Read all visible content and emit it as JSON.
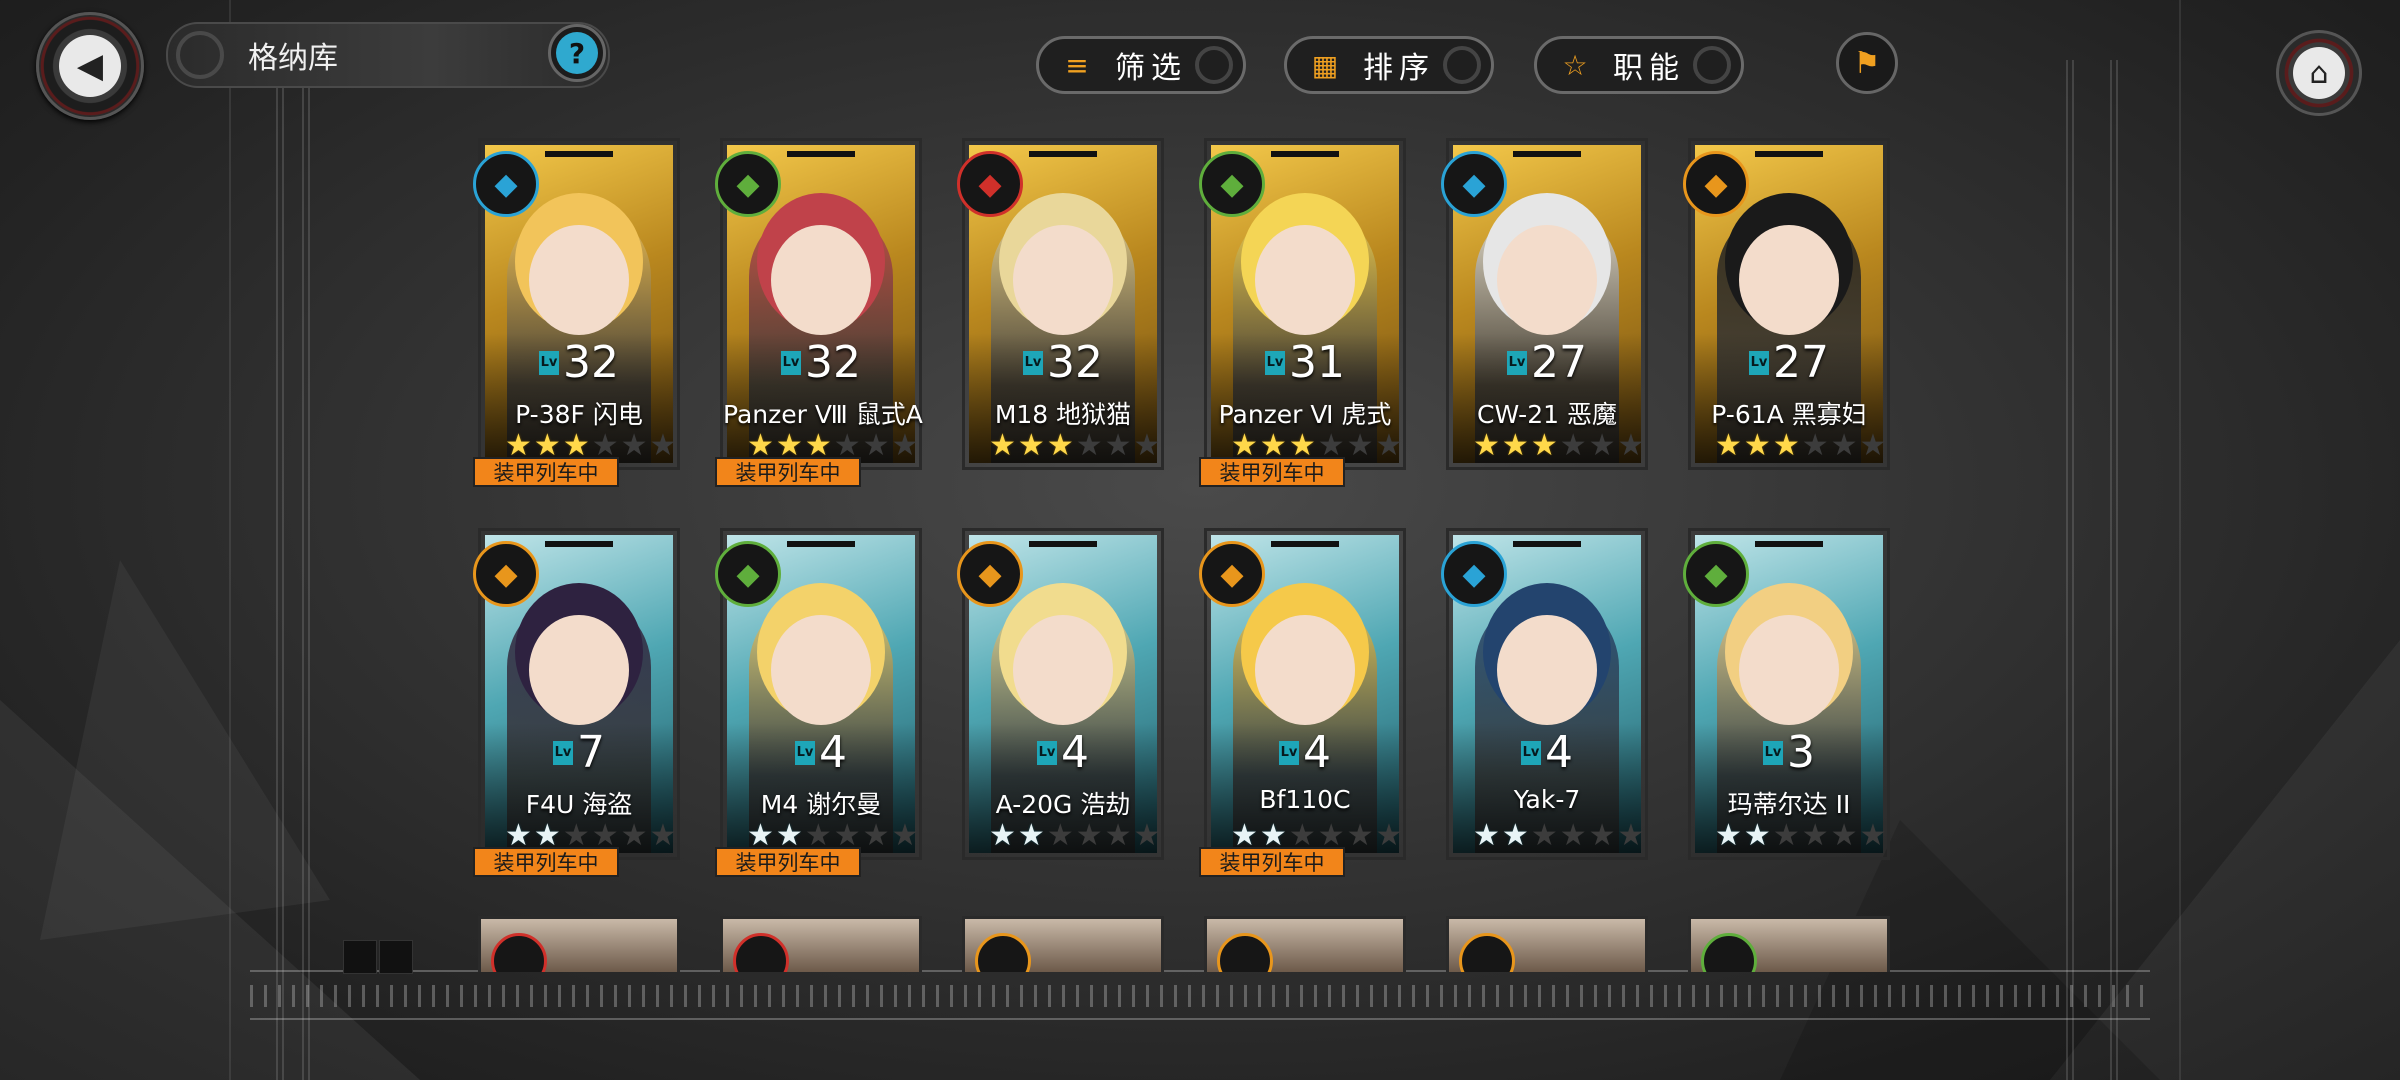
{
  "header": {
    "title": "格纳库",
    "help_label": "?",
    "filter_label": "筛选",
    "sort_label": "排序",
    "role_label": "职能"
  },
  "status_tag": "装甲列车中",
  "colors": {
    "accent": "#f0a020",
    "tag_bg": "#f2851a",
    "level_tag": "#1ea6b8"
  },
  "cards": [
    {
      "name": "P-38F 闪电",
      "level": "32",
      "stars": 3,
      "max_stars": 6,
      "frame": "gold",
      "badge_color": "#2aa3d6",
      "hair": "#f2c45a",
      "deployed": true
    },
    {
      "name": "Panzer Ⅷ 鼠式A",
      "level": "32",
      "stars": 3,
      "max_stars": 6,
      "frame": "gold",
      "badge_color": "#5fae3c",
      "hair": "#c0424a",
      "deployed": true
    },
    {
      "name": "M18 地狱猫",
      "level": "32",
      "stars": 3,
      "max_stars": 6,
      "frame": "gold",
      "badge_color": "#d0302a",
      "hair": "#e9d79a",
      "deployed": false
    },
    {
      "name": "Panzer Ⅵ 虎式",
      "level": "31",
      "stars": 3,
      "max_stars": 6,
      "frame": "gold",
      "badge_color": "#5fae3c",
      "hair": "#f4d555",
      "deployed": true
    },
    {
      "name": "CW-21 恶魔",
      "level": "27",
      "stars": 3,
      "max_stars": 6,
      "frame": "gold",
      "badge_color": "#2aa3d6",
      "hair": "#e6e6e6",
      "deployed": false
    },
    {
      "name": "P-61A 黑寡妇",
      "level": "27",
      "stars": 3,
      "max_stars": 6,
      "frame": "gold",
      "badge_color": "#e8961c",
      "hair": "#1a1a1a",
      "deployed": false
    },
    {
      "name": "F4U 海盗",
      "level": "7",
      "stars": 2,
      "max_stars": 6,
      "frame": "teal",
      "badge_color": "#e8961c",
      "hair": "#2e2240",
      "deployed": true
    },
    {
      "name": "M4 谢尔曼",
      "level": "4",
      "stars": 2,
      "max_stars": 6,
      "frame": "teal",
      "badge_color": "#5fae3c",
      "hair": "#f3d26a",
      "deployed": true
    },
    {
      "name": "A-20G 浩劫",
      "level": "4",
      "stars": 2,
      "max_stars": 6,
      "frame": "teal",
      "badge_color": "#e8961c",
      "hair": "#f1dc8e",
      "deployed": false
    },
    {
      "name": "Bf110C",
      "level": "4",
      "stars": 2,
      "max_stars": 6,
      "frame": "teal",
      "badge_color": "#e8961c",
      "hair": "#f5c94a",
      "deployed": true
    },
    {
      "name": "Yak-7",
      "level": "4",
      "stars": 2,
      "max_stars": 6,
      "frame": "teal",
      "badge_color": "#2aa3d6",
      "hair": "#23446e",
      "deployed": false
    },
    {
      "name": "玛蒂尔达 II",
      "level": "3",
      "stars": 2,
      "max_stars": 6,
      "frame": "teal",
      "badge_color": "#5fae3c",
      "hair": "#f2cf82",
      "deployed": false
    }
  ],
  "partial_row_badges": [
    "#d0302a",
    "#d0302a",
    "#e8961c",
    "#e8961c",
    "#e8961c",
    "#5fae3c"
  ]
}
